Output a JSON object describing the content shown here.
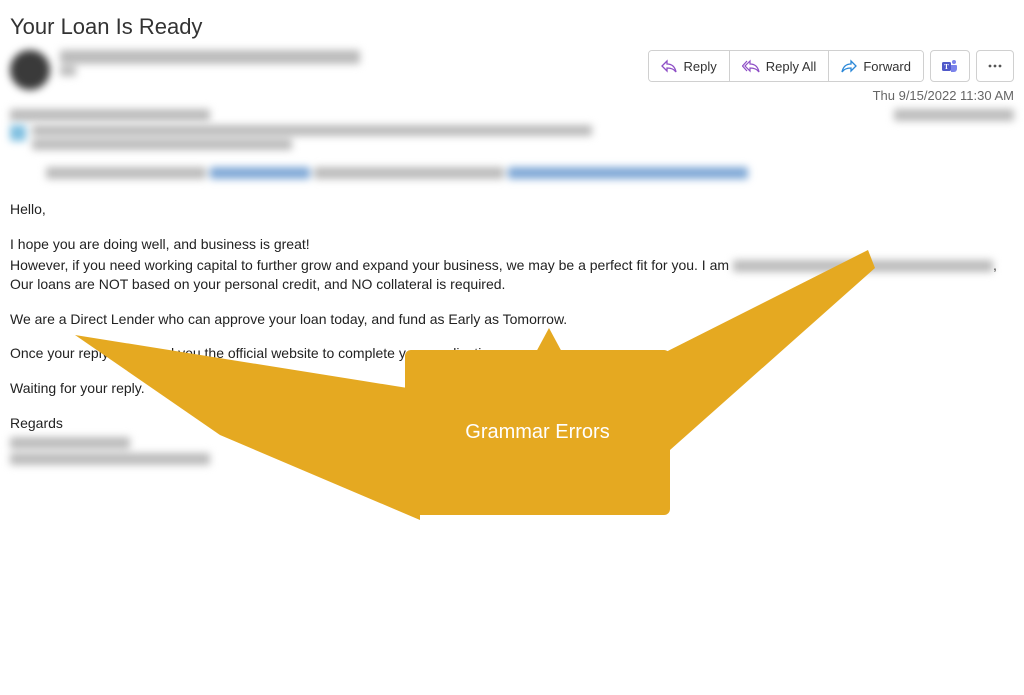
{
  "subject": "Your Loan Is Ready",
  "actions": {
    "reply": "Reply",
    "reply_all": "Reply All",
    "forward": "Forward"
  },
  "timestamp": "Thu 9/15/2022 11:30 AM",
  "body": {
    "greeting": "Hello,",
    "line1": "I hope you are doing well, and business is great!",
    "line2a": "However, if you need working capital to further grow and expand your business, we may be a perfect fit for you. I am ",
    "line2b": ", Our loans are NOT based on your personal credit, and NO collateral is required.",
    "line3": "We are a Direct Lender who can approve your loan today, and fund as Early as Tomorrow.",
    "line4": "Once your reply I will send you the official website to complete your application",
    "line5": "Waiting for your reply.",
    "signoff": "Regards"
  },
  "callout": {
    "label": "Grammar Errors"
  }
}
